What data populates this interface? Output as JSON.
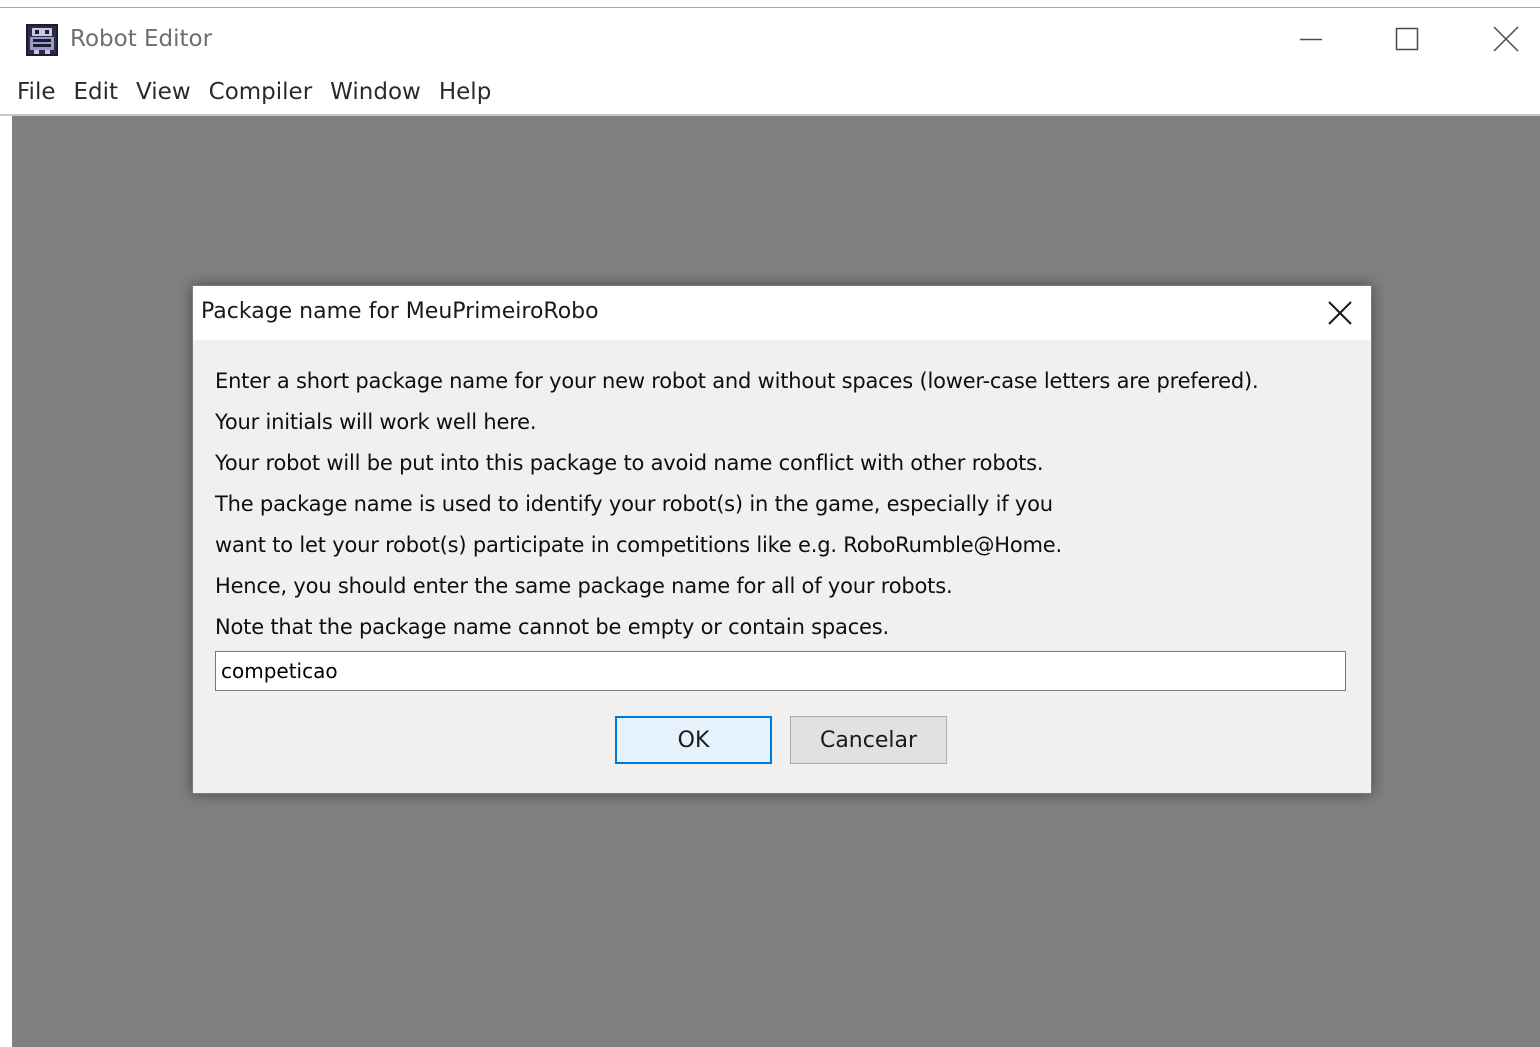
{
  "window": {
    "title": "Robot Editor"
  },
  "menubar": {
    "items": [
      "File",
      "Edit",
      "View",
      "Compiler",
      "Window",
      "Help"
    ]
  },
  "dialog": {
    "title": "Package name for MeuPrimeiroRobo",
    "message_lines": [
      "Enter a short package name for your new robot and without spaces (lower-case letters are prefered).",
      "Your initials will work well here.",
      "Your robot will be put into this package to avoid name conflict with other robots.",
      "The package name is used to identify your robot(s) in the game, especially if you",
      "want to let your robot(s) participate in competitions like e.g. RoboRumble@Home.",
      "Hence, you should enter the same package name for all of your robots.",
      "Note that the package name cannot be empty or contain spaces."
    ],
    "input_value": "competicao",
    "ok_label": "OK",
    "cancel_label": "Cancelar"
  },
  "colors": {
    "client_background": "#808080",
    "dialog_background": "#f0f0f0",
    "focus_border": "#0078d7"
  },
  "icons": {
    "app": "robot-app-icon",
    "minimize": "minimize-icon",
    "maximize": "maximize-icon",
    "close": "close-icon",
    "dialog_close": "close-icon"
  }
}
